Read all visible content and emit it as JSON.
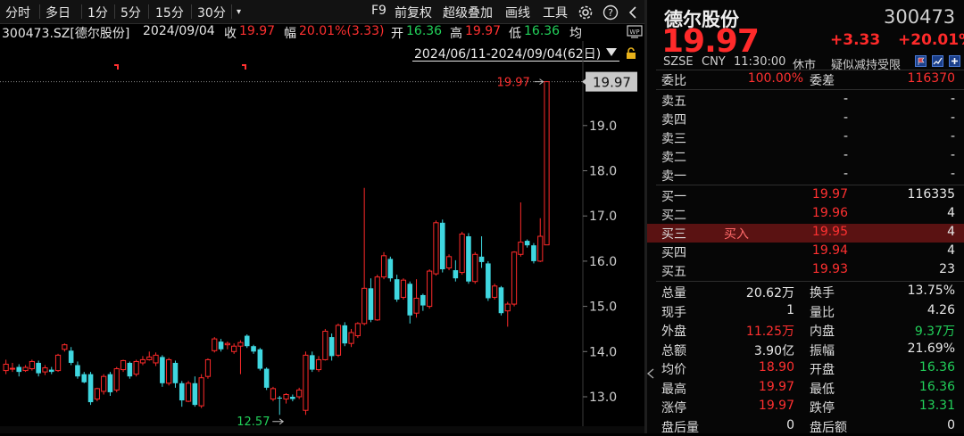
{
  "toolbar": {
    "items": [
      "分时",
      "多日",
      "1分",
      "5分",
      "15分",
      "30分",
      "▾",
      "F9",
      "前复权",
      "超级叠加",
      "画线",
      "工具"
    ]
  },
  "info": {
    "symbol": "300473.SZ[德尔股份]",
    "date": "2024/09/04",
    "close_label": "收",
    "close": "19.97",
    "amp_label": "幅",
    "amp": "20.01%(3.33)",
    "open_label": "开",
    "open": "16.36",
    "high_label": "高",
    "high": "19.97",
    "low_label": "低",
    "low": "16.36",
    "avg_label": "均",
    "range": "2024/06/11-2024/09/04(62日)"
  },
  "chart": {
    "y_ticks": [
      "19.0",
      "18.0",
      "17.0",
      "16.0",
      "15.0",
      "14.0",
      "13.0"
    ],
    "current_price_tag": "19.97",
    "high_annotation": "19.97",
    "low_annotation": "12.57"
  },
  "chart_data": {
    "type": "candlestick",
    "ylim": [
      12.5,
      20.1
    ],
    "y_ticks": [
      13,
      14,
      15,
      16,
      17,
      18,
      19
    ],
    "candles": [
      [
        13.58,
        13.72,
        13.5,
        13.82
      ],
      [
        13.62,
        13.63,
        13.55,
        13.75
      ],
      [
        13.66,
        13.55,
        13.45,
        13.72
      ],
      [
        13.58,
        13.65,
        13.55,
        13.7
      ],
      [
        13.62,
        13.78,
        13.58,
        13.82
      ],
      [
        13.75,
        13.52,
        13.45,
        13.8
      ],
      [
        13.55,
        13.64,
        13.48,
        13.7
      ],
      [
        13.6,
        13.55,
        13.5,
        13.66
      ],
      [
        13.58,
        13.92,
        13.55,
        13.95
      ],
      [
        14.05,
        14.15,
        14.0,
        14.18
      ],
      [
        14.02,
        13.75,
        13.7,
        14.1
      ],
      [
        13.7,
        13.45,
        13.4,
        13.78
      ],
      [
        13.5,
        13.32,
        13.3,
        13.55
      ],
      [
        13.5,
        12.88,
        12.82,
        13.55
      ],
      [
        12.95,
        13.18,
        12.9,
        13.2
      ],
      [
        13.12,
        13.45,
        13.05,
        13.5
      ],
      [
        13.5,
        13.1,
        13.02,
        13.55
      ],
      [
        13.15,
        13.62,
        13.1,
        13.66
      ],
      [
        13.6,
        13.8,
        13.55,
        13.82
      ],
      [
        13.75,
        13.45,
        13.4,
        13.78
      ],
      [
        13.5,
        13.78,
        13.45,
        13.82
      ],
      [
        13.75,
        13.82,
        13.7,
        13.9
      ],
      [
        13.82,
        13.88,
        13.8,
        14.0
      ],
      [
        13.75,
        13.92,
        13.68,
        13.98
      ],
      [
        13.88,
        13.3,
        13.22,
        13.92
      ],
      [
        13.3,
        13.82,
        13.25,
        13.86
      ],
      [
        13.75,
        13.3,
        13.2,
        13.8
      ],
      [
        13.3,
        12.92,
        12.78,
        13.35
      ],
      [
        12.9,
        13.3,
        12.88,
        13.35
      ],
      [
        13.3,
        12.82,
        12.78,
        13.45
      ],
      [
        12.8,
        13.42,
        12.75,
        13.5
      ],
      [
        13.45,
        13.82,
        13.4,
        13.85
      ],
      [
        14.02,
        14.28,
        13.98,
        14.32
      ],
      [
        14.22,
        14.05,
        14.0,
        14.28
      ],
      [
        14.15,
        14.18,
        14.05,
        14.22
      ],
      [
        14.0,
        14.12,
        13.95,
        14.18
      ],
      [
        14.12,
        14.2,
        13.5,
        14.25
      ],
      [
        14.35,
        14.12,
        14.08,
        14.38
      ],
      [
        14.12,
        14.0,
        13.95,
        14.15
      ],
      [
        14.05,
        13.62,
        13.58,
        14.08
      ],
      [
        13.62,
        13.2,
        13.15,
        13.65
      ],
      [
        12.95,
        13.18,
        12.9,
        13.22
      ],
      [
        12.98,
        12.97,
        12.6,
        13.02
      ],
      [
        12.95,
        13.05,
        12.85,
        13.08
      ],
      [
        13.0,
        12.95,
        12.9,
        13.05
      ],
      [
        13.0,
        13.15,
        12.95,
        13.2
      ],
      [
        12.7,
        13.92,
        12.6,
        14.0
      ],
      [
        13.92,
        13.6,
        13.55,
        14.0
      ],
      [
        13.6,
        13.82,
        13.55,
        13.9
      ],
      [
        13.82,
        14.45,
        13.8,
        14.5
      ],
      [
        14.32,
        13.9,
        13.8,
        14.4
      ],
      [
        13.92,
        14.58,
        13.88,
        14.62
      ],
      [
        14.58,
        14.18,
        14.12,
        14.65
      ],
      [
        14.18,
        14.42,
        14.1,
        14.5
      ],
      [
        14.35,
        14.62,
        14.3,
        14.65
      ],
      [
        14.62,
        15.4,
        14.58,
        17.62
      ],
      [
        15.4,
        14.7,
        14.65,
        15.62
      ],
      [
        14.7,
        15.65,
        14.68,
        15.7
      ],
      [
        15.65,
        16.12,
        15.6,
        16.2
      ],
      [
        16.05,
        15.62,
        15.55,
        16.1
      ],
      [
        15.6,
        15.15,
        15.1,
        15.7
      ],
      [
        15.2,
        15.58,
        15.15,
        15.62
      ],
      [
        15.5,
        14.8,
        14.62,
        15.55
      ],
      [
        14.85,
        15.18,
        14.75,
        15.6
      ],
      [
        15.25,
        15.02,
        14.9,
        15.28
      ],
      [
        15.0,
        15.78,
        14.95,
        15.82
      ],
      [
        15.72,
        16.85,
        15.68,
        16.9
      ],
      [
        16.85,
        15.82,
        15.75,
        16.92
      ],
      [
        15.85,
        16.1,
        15.8,
        16.15
      ],
      [
        15.8,
        15.62,
        15.55,
        16.02
      ],
      [
        15.75,
        16.6,
        15.7,
        16.65
      ],
      [
        16.55,
        15.55,
        15.5,
        16.62
      ],
      [
        15.55,
        16.15,
        15.5,
        16.2
      ],
      [
        16.1,
        15.98,
        15.85,
        16.55
      ],
      [
        15.95,
        15.18,
        15.12,
        16.0
      ],
      [
        15.2,
        15.45,
        15.15,
        15.5
      ],
      [
        15.42,
        14.85,
        14.8,
        15.45
      ],
      [
        14.9,
        15.05,
        14.55,
        15.1
      ],
      [
        15.05,
        16.2,
        15.0,
        16.22
      ],
      [
        16.15,
        16.42,
        16.1,
        17.3
      ],
      [
        16.45,
        16.35,
        16.3,
        16.48
      ],
      [
        16.35,
        16.0,
        15.95,
        16.4
      ],
      [
        16.0,
        16.55,
        15.98,
        16.95
      ],
      [
        16.36,
        19.97,
        16.36,
        19.97
      ]
    ]
  },
  "quote": {
    "name": "德尔股份",
    "code": "300473",
    "price": "19.97",
    "change": "+3.33",
    "change_pct": "+20.01%",
    "exchange": "SZSE",
    "currency": "CNY",
    "time": "11:30:00",
    "status": "休市",
    "note": "疑似减持受限",
    "weibi_label": "委比",
    "weibi": "100.00%",
    "weicha_label": "委差",
    "weicha": "116370"
  },
  "asks": [
    {
      "label": "卖五",
      "price": "-",
      "vol": "-"
    },
    {
      "label": "卖四",
      "price": "-",
      "vol": "-"
    },
    {
      "label": "卖三",
      "price": "-",
      "vol": "-"
    },
    {
      "label": "卖二",
      "price": "-",
      "vol": "-"
    },
    {
      "label": "卖一",
      "price": "-",
      "vol": "-"
    }
  ],
  "bids": [
    {
      "label": "买一",
      "tag": "",
      "price": "19.97",
      "vol": "116335"
    },
    {
      "label": "买二",
      "tag": "",
      "price": "19.96",
      "vol": "4"
    },
    {
      "label": "买三",
      "tag": "买入",
      "price": "19.95",
      "vol": "4"
    },
    {
      "label": "买四",
      "tag": "",
      "price": "19.94",
      "vol": "4"
    },
    {
      "label": "买五",
      "tag": "",
      "price": "19.93",
      "vol": "23"
    }
  ],
  "stats": [
    {
      "l1": "总量",
      "v1": "20.62万",
      "c1": "white",
      "l2": "换手",
      "v2": "13.75%",
      "c2": "white"
    },
    {
      "l1": "现手",
      "v1": "1",
      "c1": "white",
      "l2": "量比",
      "v2": "4.26",
      "c2": "white"
    },
    {
      "l1": "外盘",
      "v1": "11.25万",
      "c1": "red",
      "l2": "内盘",
      "v2": "9.37万",
      "c2": "green"
    },
    {
      "l1": "总额",
      "v1": "3.90亿",
      "c1": "white",
      "l2": "振幅",
      "v2": "21.69%",
      "c2": "white"
    },
    {
      "l1": "均价",
      "v1": "18.90",
      "c1": "red",
      "l2": "开盘",
      "v2": "16.36",
      "c2": "green"
    },
    {
      "l1": "最高",
      "v1": "19.97",
      "c1": "red",
      "l2": "最低",
      "v2": "16.36",
      "c2": "green"
    },
    {
      "l1": "涨停",
      "v1": "19.97",
      "c1": "red",
      "l2": "跌停",
      "v2": "13.31",
      "c2": "green"
    },
    {
      "l1": "盘后量",
      "v1": "0",
      "c1": "white",
      "l2": "盘后额",
      "v2": "0",
      "c2": "white"
    }
  ],
  "colors": {
    "up": "#ff2a2a",
    "down": "#3fd7e0",
    "green": "#22d15a"
  }
}
